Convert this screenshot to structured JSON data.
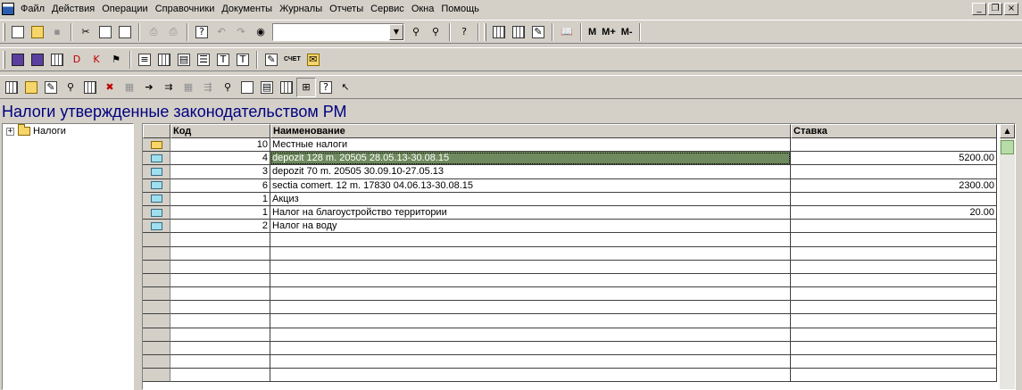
{
  "menu": [
    "Файл",
    "Действия",
    "Операции",
    "Справочники",
    "Документы",
    "Журналы",
    "Отчеты",
    "Сервис",
    "Окна",
    "Помощь"
  ],
  "window_controls": {
    "minimize": "_",
    "restore": "❐",
    "close": "×"
  },
  "toolbar1": {
    "combo_value": "",
    "memory_buttons": [
      "M",
      "M+",
      "M-"
    ]
  },
  "toolbar2": {
    "report_label": "СЧЕТ"
  },
  "page_title": "Налоги утвержденные законодательством РМ",
  "tree": {
    "expander": "+",
    "root_label": "Налоги"
  },
  "grid": {
    "headers": {
      "code": "Код",
      "name": "Наименование",
      "rate": "Ставка"
    },
    "rows": [
      {
        "code": "10",
        "name": "Местные налоги",
        "rate": ""
      },
      {
        "code": "4",
        "name": "depozit 128 m. 20505 28.05.13-30.08.15",
        "rate": "5200.00"
      },
      {
        "code": "3",
        "name": "depozit 70 m. 20505 30.09.10-27.05.13",
        "rate": ""
      },
      {
        "code": "6",
        "name": "sectia comert. 12 m. 17830   04.06.13-30.08.15",
        "rate": "2300.00"
      },
      {
        "code": "1",
        "name": "Акциз",
        "rate": ""
      },
      {
        "code": "1",
        "name": "Налог на благоустройство территории",
        "rate": "20.00"
      },
      {
        "code": "2",
        "name": "Налог на воду",
        "rate": ""
      }
    ],
    "selected_row": 1,
    "empty_rows": 11
  },
  "colors": {
    "title": "#000080",
    "selection": "#6f8a5e",
    "background": "#d4d0c8"
  }
}
